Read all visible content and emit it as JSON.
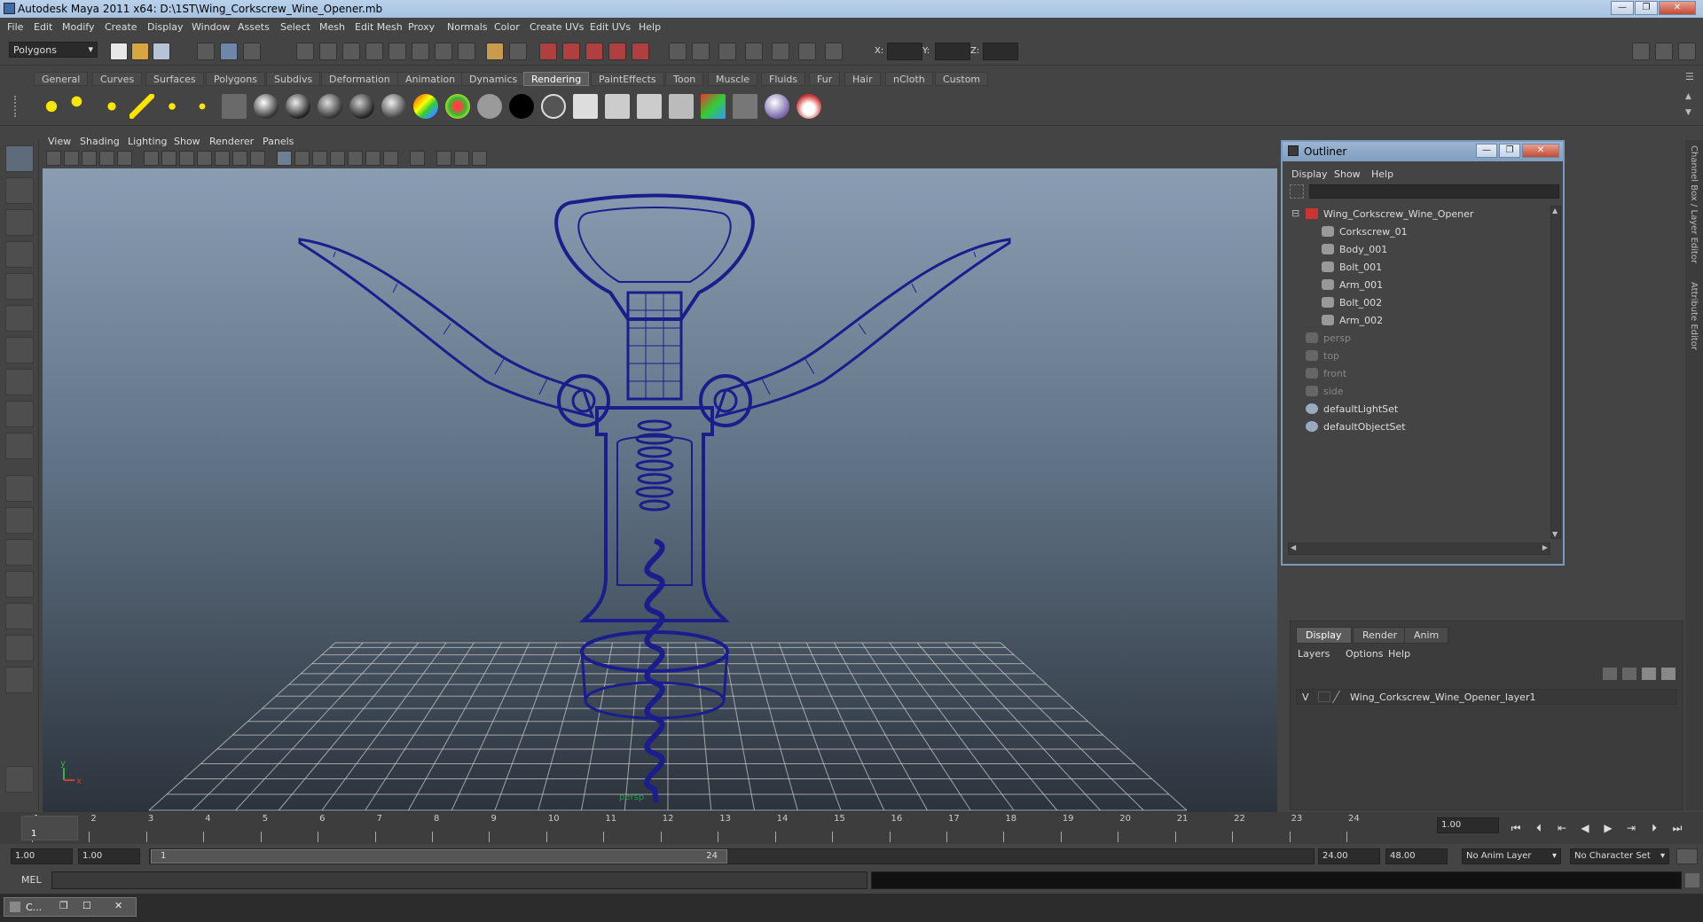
{
  "window": {
    "title": "Autodesk Maya 2011 x64: D:\\1ST\\Wing_Corkscrew_Wine_Opener.mb",
    "controls": [
      "—",
      "❐",
      "✕"
    ]
  },
  "menubar": [
    "File",
    "Edit",
    "Modify",
    "Create",
    "Display",
    "Window",
    "Assets",
    "Select",
    "Mesh",
    "Edit Mesh",
    "Proxy",
    "Normals",
    "Color",
    "Create UVs",
    "Edit UVs",
    "Help"
  ],
  "statusline": {
    "mode": "Polygons",
    "x_label": "X:",
    "y_label": "Y:",
    "z_label": "Z:"
  },
  "shelf_tabs": [
    "General",
    "Curves",
    "Surfaces",
    "Polygons",
    "Subdivs",
    "Deformation",
    "Animation",
    "Dynamics",
    "Rendering",
    "PaintEffects",
    "Toon",
    "Muscle",
    "Fluids",
    "Fur",
    "Hair",
    "nCloth",
    "Custom"
  ],
  "shelf_active_tab": "Rendering",
  "panel": {
    "menus": [
      "View",
      "Shading",
      "Lighting",
      "Show",
      "Renderer",
      "Panels"
    ],
    "camera_label": "persp",
    "axis_y": "y",
    "axis_x": "x"
  },
  "outliner": {
    "title": "Outliner",
    "controls": [
      "—",
      "❐",
      "✕"
    ],
    "menus": [
      "Display",
      "Show",
      "Help"
    ],
    "items": [
      {
        "label": "Wing_Corkscrew_Wine_Opener",
        "indent": 0,
        "type": "group",
        "dim": false
      },
      {
        "label": "Corkscrew_01",
        "indent": 1,
        "type": "mesh",
        "dim": false
      },
      {
        "label": "Body_001",
        "indent": 1,
        "type": "mesh",
        "dim": false
      },
      {
        "label": "Bolt_001",
        "indent": 1,
        "type": "mesh",
        "dim": false
      },
      {
        "label": "Arm_001",
        "indent": 1,
        "type": "mesh",
        "dim": false
      },
      {
        "label": "Bolt_002",
        "indent": 1,
        "type": "mesh",
        "dim": false
      },
      {
        "label": "Arm_002",
        "indent": 1,
        "type": "mesh",
        "dim": false
      },
      {
        "label": "persp",
        "indent": 0,
        "type": "camera",
        "dim": true
      },
      {
        "label": "top",
        "indent": 0,
        "type": "camera",
        "dim": true
      },
      {
        "label": "front",
        "indent": 0,
        "type": "camera",
        "dim": true
      },
      {
        "label": "side",
        "indent": 0,
        "type": "camera",
        "dim": true
      },
      {
        "label": "defaultLightSet",
        "indent": 0,
        "type": "set",
        "dim": false
      },
      {
        "label": "defaultObjectSet",
        "indent": 0,
        "type": "set",
        "dim": false
      }
    ]
  },
  "layer_editor": {
    "tabs": [
      "Display",
      "Render",
      "Anim"
    ],
    "active_tab": "Display",
    "menus": [
      "Layers",
      "Options",
      "Help"
    ],
    "layer_visible": "V",
    "layer_name": "Wing_Corkscrew_Wine_Opener_layer1"
  },
  "side_tabs": [
    "Channel Box / Layer Editor",
    "Attribute Editor"
  ],
  "time_slider": {
    "ticks": [
      "1",
      "2",
      "3",
      "4",
      "5",
      "6",
      "7",
      "8",
      "9",
      "10",
      "11",
      "12",
      "13",
      "14",
      "15",
      "16",
      "17",
      "18",
      "19",
      "20",
      "21",
      "22",
      "23",
      "24"
    ],
    "current_frame_marker": "1",
    "current_time": "1.00"
  },
  "range_slider": {
    "start_time": "1.00",
    "playback_start": "1.00",
    "range_start_label": "1",
    "range_end_label": "24",
    "playback_end": "24.00",
    "end_time": "48.00",
    "anim_layer": "No Anim Layer",
    "character_set": "No Character Set"
  },
  "command_line": {
    "label": "MEL"
  },
  "taskbar": {
    "item": "C..."
  },
  "colors": {
    "wireframe": "#1b1d8c",
    "grid": "#c8c8c8",
    "accent_blue": "#7a9bbf"
  }
}
